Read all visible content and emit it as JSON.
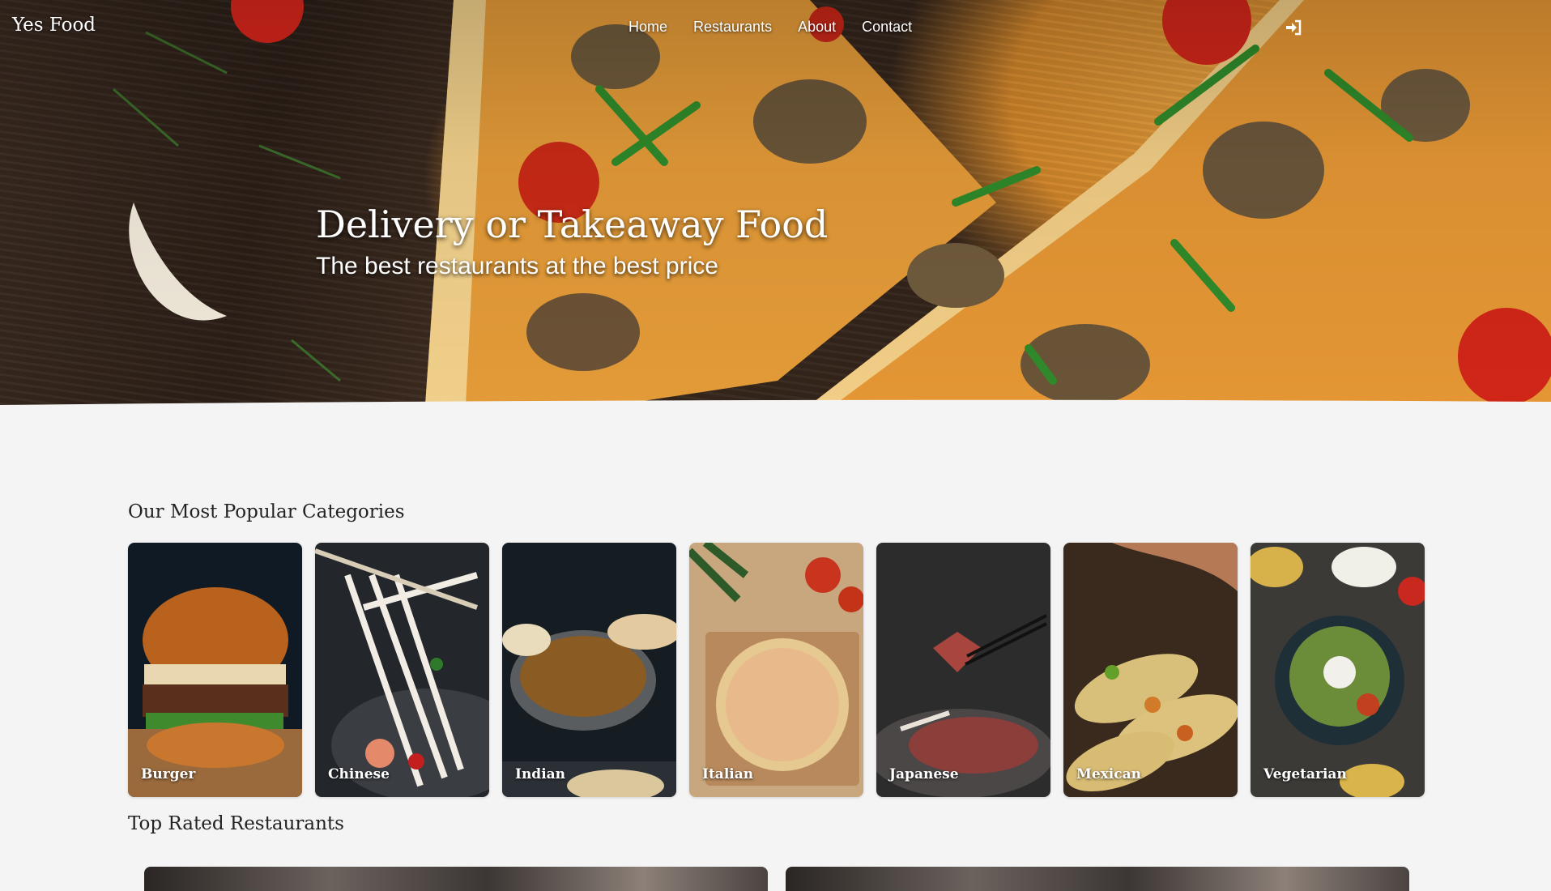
{
  "header": {
    "brand": "Yes Food",
    "nav": [
      {
        "label": "Home"
      },
      {
        "label": "Restaurants"
      },
      {
        "label": "About"
      },
      {
        "label": "Contact"
      }
    ],
    "login_icon": "sign-in-icon"
  },
  "hero": {
    "title": "Delivery or Takeaway Food",
    "subtitle": "The best restaurants at the best price"
  },
  "categories_section": {
    "title": "Our Most Popular Categories",
    "items": [
      {
        "label": "Burger"
      },
      {
        "label": "Chinese"
      },
      {
        "label": "Indian"
      },
      {
        "label": "Italian"
      },
      {
        "label": "Japanese"
      },
      {
        "label": "Mexican"
      },
      {
        "label": "Vegetarian"
      }
    ]
  },
  "restaurants_section": {
    "title": "Top Rated Restaurants"
  },
  "colors": {
    "background": "#f4f4f4",
    "text": "#222222",
    "hero_text": "#ffffff"
  }
}
